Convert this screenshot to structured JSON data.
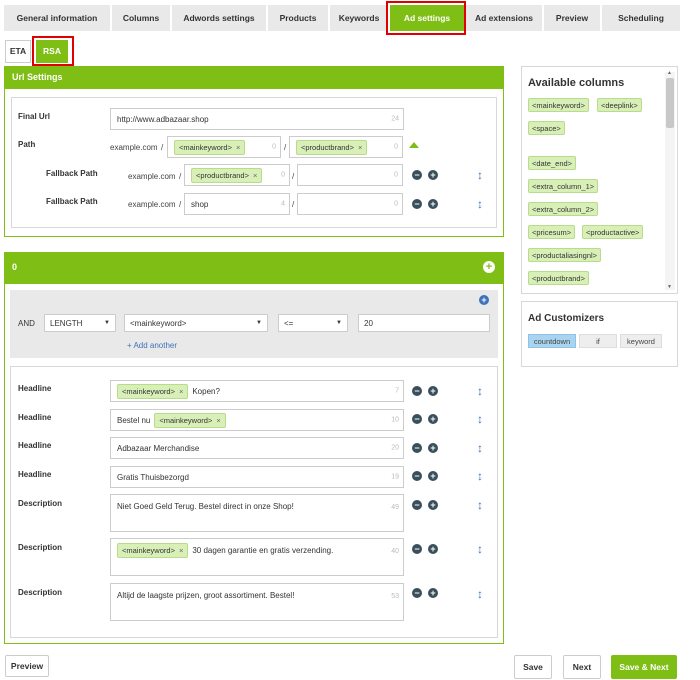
{
  "tabs": [
    {
      "label": "General information"
    },
    {
      "label": "Columns"
    },
    {
      "label": "Adwords settings"
    },
    {
      "label": "Products"
    },
    {
      "label": "Keywords"
    },
    {
      "label": "Ad settings"
    },
    {
      "label": "Ad extensions"
    },
    {
      "label": "Preview"
    },
    {
      "label": "Scheduling"
    }
  ],
  "subtabs": [
    {
      "label": "ETA"
    },
    {
      "label": "RSA"
    }
  ],
  "url_settings": {
    "title": "Url Settings",
    "final_url_label": "Final Url",
    "final_url_value": "http://www.adbazaar.shop",
    "final_url_count": "24",
    "path_label": "Path",
    "domain": "example.com",
    "path1_chip": "<mainkeyword>",
    "path1_count": "0",
    "path2_chip": "<productbrand>",
    "path2_count": "0",
    "fallback1_label": "Fallback Path",
    "fallback1_chip": "<productbrand>",
    "fallback1_count": "0",
    "fallback1_count2": "0",
    "fallback2_label": "Fallback Path",
    "fallback2_value": "shop",
    "fallback2_count": "4",
    "fallback2_count2": "0",
    "slash": "/"
  },
  "group": {
    "title": "0",
    "condition": {
      "and": "AND",
      "field": "LENGTH",
      "column": "<mainkeyword>",
      "operator": "<=",
      "value": "20"
    },
    "add_another": "+ Add another",
    "rows": [
      {
        "label": "Headline",
        "chip": "<mainkeyword>",
        "text": "Kopen?",
        "count": "7"
      },
      {
        "label": "Headline",
        "prefix": "Bestel nu",
        "chip": "<mainkeyword>",
        "count": "10"
      },
      {
        "label": "Headline",
        "text": "Adbazaar Merchandise",
        "count": "20"
      },
      {
        "label": "Headline",
        "text": "Gratis Thuisbezorgd",
        "count": "19"
      },
      {
        "label": "Description",
        "text": "Niet Goed Geld Terug. Bestel direct in onze Shop!",
        "count": "49"
      },
      {
        "label": "Description",
        "chip": "<mainkeyword>",
        "text": "30 dagen garantie en gratis verzending.",
        "count": "40"
      },
      {
        "label": "Description",
        "text": "Altijd de laagste prijzen, groot assortiment. Bestel!",
        "count": "53"
      }
    ]
  },
  "available_columns": {
    "title": "Available columns",
    "items": [
      "<mainkeyword>",
      "<deeplink>",
      "<space>",
      "<date_end>",
      "<extra_column_1>",
      "<extra_column_2>",
      "<pricesum>",
      "<productactive>",
      "<productaliasingnl>",
      "<productbrand>"
    ]
  },
  "ad_customizers": {
    "title": "Ad Customizers",
    "items": [
      "countdown",
      "if",
      "keyword"
    ]
  },
  "buttons": {
    "preview": "Preview",
    "save": "Save",
    "next": "Next",
    "save_next": "Save & Next"
  },
  "colors": {
    "accent": "#7fbf15",
    "highlight": "#e00000",
    "icon_blue": "#3f72b8"
  }
}
